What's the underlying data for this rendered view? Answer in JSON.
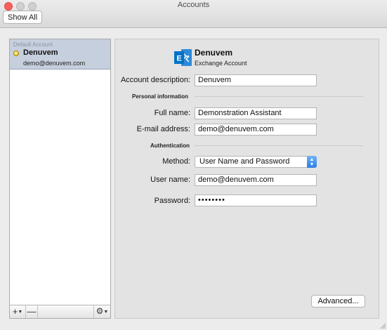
{
  "window": {
    "title": "Accounts"
  },
  "toolbar": {
    "show_all_label": "Show All"
  },
  "sidebar": {
    "group_label": "Default Account",
    "account_name": "Denuvem",
    "account_email": "demo@denuvem.com",
    "add_label": "+",
    "remove_label": "—",
    "gear_label": "⚙"
  },
  "account": {
    "name": "Denuvem",
    "type": "Exchange Account",
    "description_label": "Account description:",
    "description_value": "Denuvem"
  },
  "personal_info": {
    "heading": "Personal information",
    "full_name_label": "Full name:",
    "full_name_value": "Demonstration Assistant",
    "email_label": "E-mail address:",
    "email_value": "demo@denuvem.com"
  },
  "authentication": {
    "heading": "Authentication",
    "method_label": "Method:",
    "method_value": "User Name and Password",
    "username_label": "User name:",
    "username_value": "demo@denuvem.com",
    "password_label": "Password:",
    "password_value": "••••••••"
  },
  "footer": {
    "advanced_label": "Advanced..."
  },
  "colors": {
    "exchange_blue": "#0072c6",
    "selection": "#c6cfdd",
    "select_accent": "#2a7ee8"
  }
}
